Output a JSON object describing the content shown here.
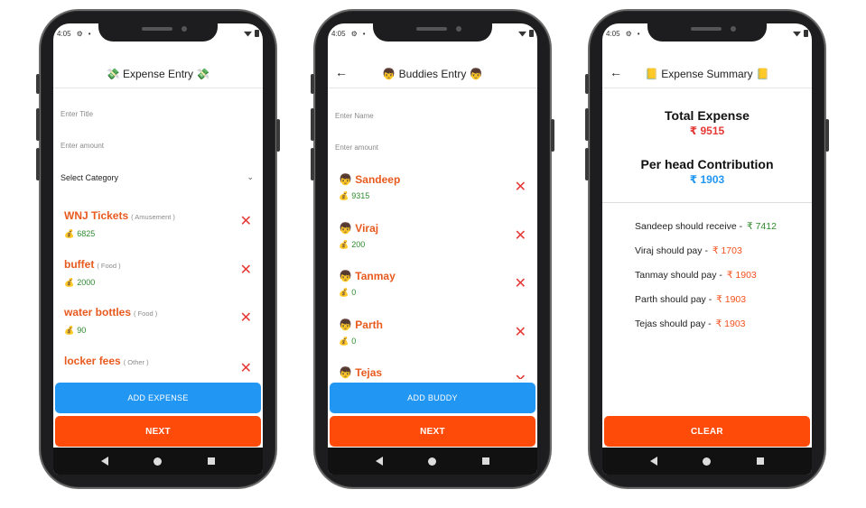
{
  "status": {
    "time": "4:05"
  },
  "screen1": {
    "title": "💸 Expense Entry 💸",
    "title_placeholder": "Enter Title",
    "amount_placeholder": "Enter amount",
    "category_select": "Select Category",
    "expenses": [
      {
        "title": "WNJ Tickets",
        "category": "( Amusement )",
        "amount": "6825"
      },
      {
        "title": "buffet",
        "category": "( Food )",
        "amount": "2000"
      },
      {
        "title": "water bottles",
        "category": "( Food )",
        "amount": "90"
      },
      {
        "title": "locker fees",
        "category": "( Other )",
        "amount": ""
      }
    ],
    "add_button": "ADD EXPENSE",
    "next_button": "NEXT"
  },
  "screen2": {
    "title": "👦 Buddies Entry 👦",
    "name_placeholder": "Enter Name",
    "amount_placeholder": "Enter amount",
    "buddies": [
      {
        "name": "👦 Sandeep",
        "amount": "9315"
      },
      {
        "name": "👦 Viraj",
        "amount": "200"
      },
      {
        "name": "👦 Tanmay",
        "amount": "0"
      },
      {
        "name": "👦 Parth",
        "amount": "0"
      },
      {
        "name": "👦 Tejas",
        "amount": ""
      }
    ],
    "add_button": "ADD BUDDY",
    "next_button": "NEXT"
  },
  "screen3": {
    "title": "📒 Expense Summary 📒",
    "total_label": "Total Expense",
    "total_value": "₹ 9515",
    "perhead_label": "Per head Contribution",
    "perhead_value": "₹ 1903",
    "settlements": [
      {
        "text": "Sandeep should receive - ",
        "amount": "₹ 7412",
        "type": "receive"
      },
      {
        "text": "Viraj should pay - ",
        "amount": "₹ 1703",
        "type": "pay"
      },
      {
        "text": "Tanmay should pay - ",
        "amount": "₹ 1903",
        "type": "pay"
      },
      {
        "text": "Parth should pay - ",
        "amount": "₹ 1903",
        "type": "pay"
      },
      {
        "text": "Tejas should pay - ",
        "amount": "₹ 1903",
        "type": "pay"
      }
    ],
    "clear_button": "CLEAR"
  },
  "icons": {
    "delete": "✕",
    "money_bag": "💰",
    "back": "←",
    "settings": "⚙",
    "chevron": "⌄"
  },
  "colors": {
    "accent_blue": "#2196f3",
    "accent_orange": "#ff4b0a",
    "title_orange": "#e85a1f",
    "amount_green": "#2d8a2d",
    "delete_red": "#e53935",
    "total_red": "#e53935",
    "perhead_blue": "#2196f3",
    "pay_red": "#f4511e",
    "receive_green": "#2d8a2d"
  }
}
